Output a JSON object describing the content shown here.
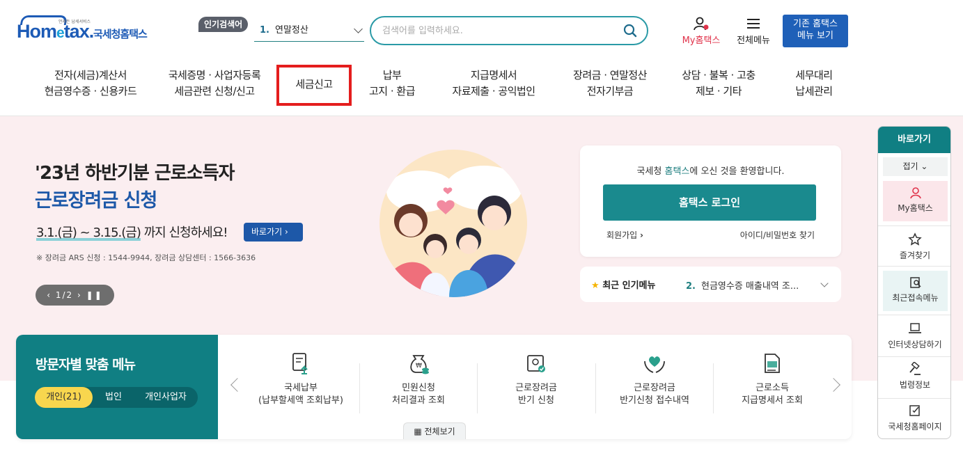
{
  "brand": {
    "logo_small": "언제든 납세서비스",
    "logo_home": "Hom",
    "logo_e": "e",
    "logo_tax": "tax.",
    "name": "국세청홈택스"
  },
  "header": {
    "popular_badge": "인기검색어",
    "popular_num": "1.",
    "popular_term": "연말정산",
    "search_placeholder": "검색어를 입력하세요.",
    "my_hometax": "My홈택스",
    "all_menu": "전체메뉴",
    "old_menu_line1": "기존 홈택스",
    "old_menu_line2": "메뉴 보기"
  },
  "gnb": [
    {
      "line1": "전자(세금)계산서",
      "line2": "현금영수증 · 신용카드"
    },
    {
      "line1": "국세증명 · 사업자등록",
      "line2": "세금관련 신청/신고"
    },
    {
      "line1": "세금신고",
      "line2": ""
    },
    {
      "line1": "납부",
      "line2": "고지 · 환급"
    },
    {
      "line1": "지급명세서",
      "line2": "자료제출 · 공익법인"
    },
    {
      "line1": "장려금 · 연말정산",
      "line2": "전자기부금"
    },
    {
      "line1": "상담 · 불복 · 고충",
      "line2": "제보 · 기타"
    },
    {
      "line1": "세무대리",
      "line2": "납세관리"
    }
  ],
  "hero": {
    "title1": "'23년 하반기분 근로소득자",
    "title2": "근로장려금 신청",
    "period": "3.1.(금) ~ 3.15.(금)",
    "period_suffix": " 까지 신청하세요!",
    "go_button": "바로가기",
    "note": "※ 장려금 ARS 신청 : 1544-9944, 장려금 상담센터 : 1566-3636",
    "slide_counter": "1/2"
  },
  "login": {
    "welcome_prefix": "국세청 ",
    "welcome_brand": "홈택스",
    "welcome_suffix": "에 오신 것을 환영합니다.",
    "login_button": "홈택스 로그인",
    "signup": "회원가입",
    "find": "아이디/비밀번호 찾기"
  },
  "popular_menu": {
    "title": "최근 인기메뉴",
    "num": "2.",
    "item": "현금영수증 매출내역 조..."
  },
  "visitor": {
    "title": "방문자별 맞춤 메뉴",
    "tabs": [
      "개인(21)",
      "법인",
      "개인사업자"
    ],
    "items": [
      {
        "line1": "국세납부",
        "line2": "(납부할세액 조회납부)",
        "icon": "document-upload-icon"
      },
      {
        "line1": "민원신청",
        "line2": "처리결과 조회",
        "icon": "money-bag-icon"
      },
      {
        "line1": "근로장려금",
        "line2": "반기 신청",
        "icon": "certificate-icon"
      },
      {
        "line1": "근로장려금",
        "line2": "반기신청 접수내역",
        "icon": "heart-hands-icon"
      },
      {
        "line1": "근로소득",
        "line2": "지급명세서 조회",
        "icon": "file-icon"
      }
    ],
    "view_all": "전체보기"
  },
  "quickbar": {
    "title": "바로가기",
    "fold": "접기",
    "items": [
      "My홈택스",
      "즐겨찾기",
      "최근접속메뉴",
      "인터넷상담하기",
      "법령정보",
      "국세청홈페이지"
    ]
  },
  "colors": {
    "teal": "#107f83",
    "blue": "#1d58a8",
    "red_highlight": "#e41d1d",
    "hero_bg": "#fbeef0"
  }
}
